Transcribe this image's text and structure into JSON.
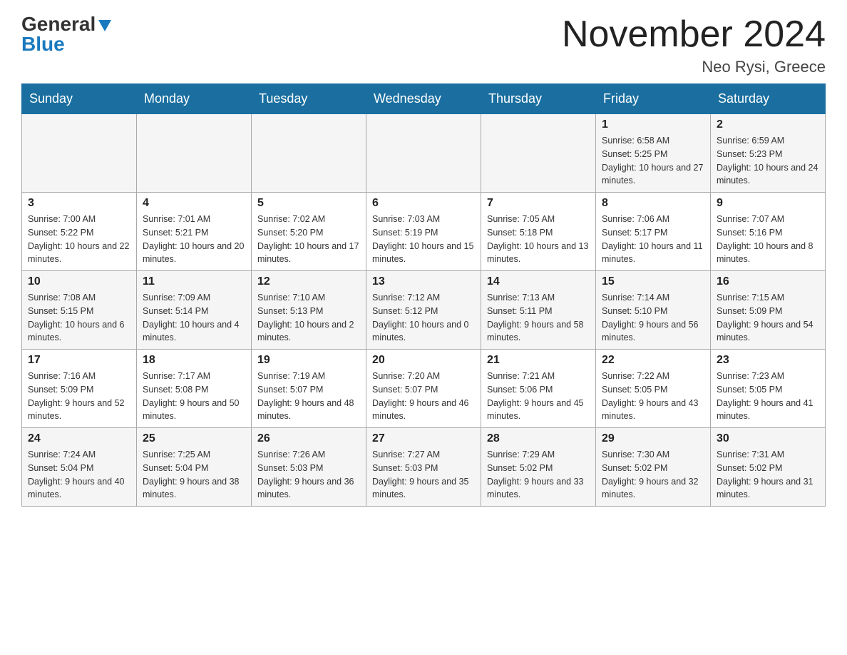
{
  "header": {
    "logo_general": "General",
    "logo_blue": "Blue",
    "month_title": "November 2024",
    "location": "Neo Rysi, Greece"
  },
  "days_of_week": [
    "Sunday",
    "Monday",
    "Tuesday",
    "Wednesday",
    "Thursday",
    "Friday",
    "Saturday"
  ],
  "weeks": [
    {
      "days": [
        {
          "date": "",
          "info": ""
        },
        {
          "date": "",
          "info": ""
        },
        {
          "date": "",
          "info": ""
        },
        {
          "date": "",
          "info": ""
        },
        {
          "date": "",
          "info": ""
        },
        {
          "date": "1",
          "info": "Sunrise: 6:58 AM\nSunset: 5:25 PM\nDaylight: 10 hours and 27 minutes."
        },
        {
          "date": "2",
          "info": "Sunrise: 6:59 AM\nSunset: 5:23 PM\nDaylight: 10 hours and 24 minutes."
        }
      ]
    },
    {
      "days": [
        {
          "date": "3",
          "info": "Sunrise: 7:00 AM\nSunset: 5:22 PM\nDaylight: 10 hours and 22 minutes."
        },
        {
          "date": "4",
          "info": "Sunrise: 7:01 AM\nSunset: 5:21 PM\nDaylight: 10 hours and 20 minutes."
        },
        {
          "date": "5",
          "info": "Sunrise: 7:02 AM\nSunset: 5:20 PM\nDaylight: 10 hours and 17 minutes."
        },
        {
          "date": "6",
          "info": "Sunrise: 7:03 AM\nSunset: 5:19 PM\nDaylight: 10 hours and 15 minutes."
        },
        {
          "date": "7",
          "info": "Sunrise: 7:05 AM\nSunset: 5:18 PM\nDaylight: 10 hours and 13 minutes."
        },
        {
          "date": "8",
          "info": "Sunrise: 7:06 AM\nSunset: 5:17 PM\nDaylight: 10 hours and 11 minutes."
        },
        {
          "date": "9",
          "info": "Sunrise: 7:07 AM\nSunset: 5:16 PM\nDaylight: 10 hours and 8 minutes."
        }
      ]
    },
    {
      "days": [
        {
          "date": "10",
          "info": "Sunrise: 7:08 AM\nSunset: 5:15 PM\nDaylight: 10 hours and 6 minutes."
        },
        {
          "date": "11",
          "info": "Sunrise: 7:09 AM\nSunset: 5:14 PM\nDaylight: 10 hours and 4 minutes."
        },
        {
          "date": "12",
          "info": "Sunrise: 7:10 AM\nSunset: 5:13 PM\nDaylight: 10 hours and 2 minutes."
        },
        {
          "date": "13",
          "info": "Sunrise: 7:12 AM\nSunset: 5:12 PM\nDaylight: 10 hours and 0 minutes."
        },
        {
          "date": "14",
          "info": "Sunrise: 7:13 AM\nSunset: 5:11 PM\nDaylight: 9 hours and 58 minutes."
        },
        {
          "date": "15",
          "info": "Sunrise: 7:14 AM\nSunset: 5:10 PM\nDaylight: 9 hours and 56 minutes."
        },
        {
          "date": "16",
          "info": "Sunrise: 7:15 AM\nSunset: 5:09 PM\nDaylight: 9 hours and 54 minutes."
        }
      ]
    },
    {
      "days": [
        {
          "date": "17",
          "info": "Sunrise: 7:16 AM\nSunset: 5:09 PM\nDaylight: 9 hours and 52 minutes."
        },
        {
          "date": "18",
          "info": "Sunrise: 7:17 AM\nSunset: 5:08 PM\nDaylight: 9 hours and 50 minutes."
        },
        {
          "date": "19",
          "info": "Sunrise: 7:19 AM\nSunset: 5:07 PM\nDaylight: 9 hours and 48 minutes."
        },
        {
          "date": "20",
          "info": "Sunrise: 7:20 AM\nSunset: 5:07 PM\nDaylight: 9 hours and 46 minutes."
        },
        {
          "date": "21",
          "info": "Sunrise: 7:21 AM\nSunset: 5:06 PM\nDaylight: 9 hours and 45 minutes."
        },
        {
          "date": "22",
          "info": "Sunrise: 7:22 AM\nSunset: 5:05 PM\nDaylight: 9 hours and 43 minutes."
        },
        {
          "date": "23",
          "info": "Sunrise: 7:23 AM\nSunset: 5:05 PM\nDaylight: 9 hours and 41 minutes."
        }
      ]
    },
    {
      "days": [
        {
          "date": "24",
          "info": "Sunrise: 7:24 AM\nSunset: 5:04 PM\nDaylight: 9 hours and 40 minutes."
        },
        {
          "date": "25",
          "info": "Sunrise: 7:25 AM\nSunset: 5:04 PM\nDaylight: 9 hours and 38 minutes."
        },
        {
          "date": "26",
          "info": "Sunrise: 7:26 AM\nSunset: 5:03 PM\nDaylight: 9 hours and 36 minutes."
        },
        {
          "date": "27",
          "info": "Sunrise: 7:27 AM\nSunset: 5:03 PM\nDaylight: 9 hours and 35 minutes."
        },
        {
          "date": "28",
          "info": "Sunrise: 7:29 AM\nSunset: 5:02 PM\nDaylight: 9 hours and 33 minutes."
        },
        {
          "date": "29",
          "info": "Sunrise: 7:30 AM\nSunset: 5:02 PM\nDaylight: 9 hours and 32 minutes."
        },
        {
          "date": "30",
          "info": "Sunrise: 7:31 AM\nSunset: 5:02 PM\nDaylight: 9 hours and 31 minutes."
        }
      ]
    }
  ]
}
